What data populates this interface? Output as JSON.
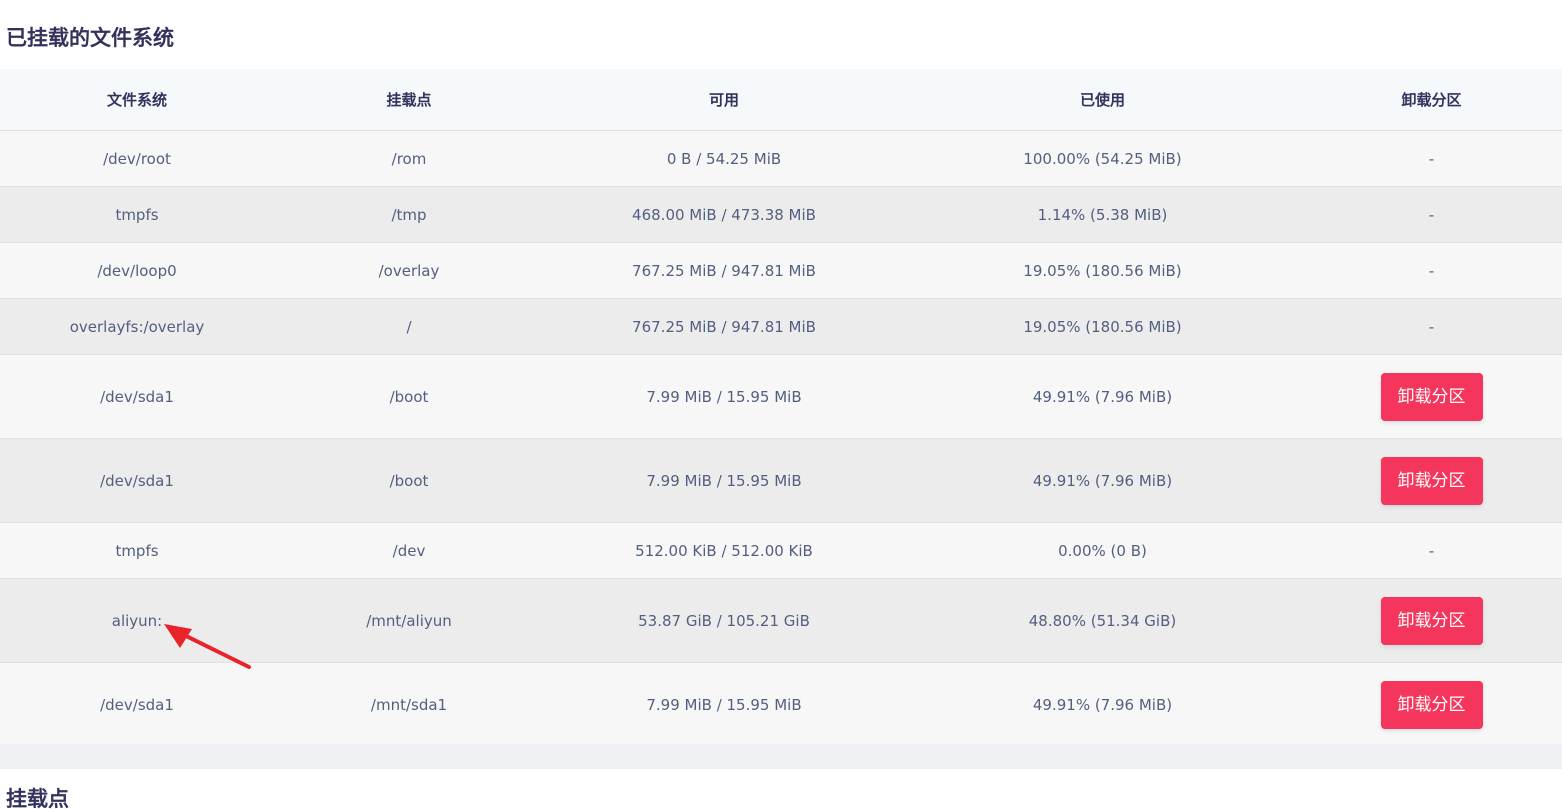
{
  "section_mounted_title": "已挂载的文件系统",
  "section_mountpoints_title": "挂载点",
  "table": {
    "headers": [
      "文件系统",
      "挂载点",
      "可用",
      "已使用",
      "卸载分区"
    ],
    "rows": [
      {
        "fs": "/dev/root",
        "mount": "/rom",
        "available": "0 B / 54.25 MiB",
        "used": "100.00% (54.25 MiB)",
        "action": "-"
      },
      {
        "fs": "tmpfs",
        "mount": "/tmp",
        "available": "468.00 MiB / 473.38 MiB",
        "used": "1.14% (5.38 MiB)",
        "action": "-"
      },
      {
        "fs": "/dev/loop0",
        "mount": "/overlay",
        "available": "767.25 MiB / 947.81 MiB",
        "used": "19.05% (180.56 MiB)",
        "action": "-"
      },
      {
        "fs": "overlayfs:/overlay",
        "mount": "/",
        "available": "767.25 MiB / 947.81 MiB",
        "used": "19.05% (180.56 MiB)",
        "action": "-"
      },
      {
        "fs": "/dev/sda1",
        "mount": "/boot",
        "available": "7.99 MiB / 15.95 MiB",
        "used": "49.91% (7.96 MiB)",
        "action": "卸载分区"
      },
      {
        "fs": "/dev/sda1",
        "mount": "/boot",
        "available": "7.99 MiB / 15.95 MiB",
        "used": "49.91% (7.96 MiB)",
        "action": "卸载分区"
      },
      {
        "fs": "tmpfs",
        "mount": "/dev",
        "available": "512.00 KiB / 512.00 KiB",
        "used": "0.00% (0 B)",
        "action": "-"
      },
      {
        "fs": "aliyun:",
        "mount": "/mnt/aliyun",
        "available": "53.87 GiB / 105.21 GiB",
        "used": "48.80% (51.34 GiB)",
        "action": "卸载分区"
      },
      {
        "fs": "/dev/sda1",
        "mount": "/mnt/sda1",
        "available": "7.99 MiB / 15.95 MiB",
        "used": "49.91% (7.96 MiB)",
        "action": "卸载分区"
      }
    ]
  },
  "colors": {
    "danger_button": "#f5365c",
    "annotation_arrow": "#e8232a",
    "header_bg": "#f6f9fc",
    "title_text": "#32325d"
  },
  "icons": {
    "annotation": "red-arrow-icon"
  }
}
